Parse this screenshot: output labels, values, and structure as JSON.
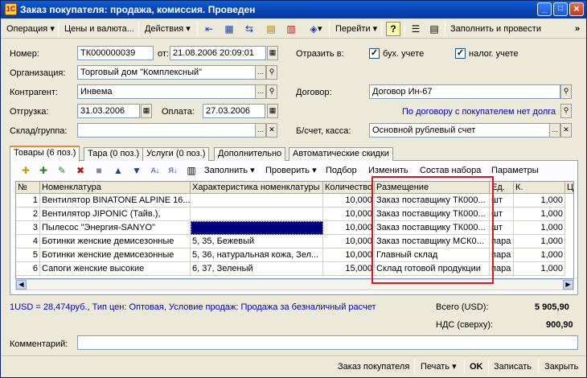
{
  "window": {
    "title": "Заказ покупателя: продажа, комиссия. Проведен",
    "minimize": "_",
    "maximize": "□",
    "close": "×"
  },
  "toolbar": {
    "operation": "Операция",
    "prices": "Цены и валюта...",
    "actions": "Действия",
    "goto": "Перейти",
    "help": "?",
    "fill_post": "Заполнить и провести",
    "overflow": "»"
  },
  "header": {
    "number_label": "Номер:",
    "number_value": "ТК000000039",
    "from_label": "от:",
    "date_value": "21.08.2006 20:09:01",
    "reflect_label": "Отразить в:",
    "accounting_label": "бух. учете",
    "tax_label": "налог. учете",
    "org_label": "Организация:",
    "org_value": "Торговый дом \"Комплексный\"",
    "contractor_label": "Контрагент:",
    "contractor_value": "Инвема",
    "contract_label": "Договор:",
    "contract_value": "Договор Ин-67",
    "shipment_label": "Отгрузка:",
    "shipment_value": "31.03.2006",
    "payment_label": "Оплата:",
    "payment_value": "27.03.2006",
    "contract_note": "По договору с покупателем нет долга",
    "warehouse_label": "Склад/группа:",
    "warehouse_value": "",
    "bank_label": "Б/счет, касса:",
    "bank_value": "Основной рублевый счет"
  },
  "tabs": [
    {
      "label": "Товары (6 поз.)"
    },
    {
      "label": "Тара (0 поз.)"
    },
    {
      "label": "Услуги (0 поз.)"
    },
    {
      "label": "Дополнительно"
    },
    {
      "label": "Автоматические скидки"
    }
  ],
  "grid_toolbar": {
    "fill": "Заполнить",
    "check": "Проверить",
    "pick": "Подбор",
    "change": "Изменить",
    "kit": "Состав набора",
    "params": "Параметры"
  },
  "table": {
    "headers": [
      "№",
      "Номенклатура",
      "Характеристика номенклатуры",
      "Количество",
      "Размещение",
      "Ед.",
      "К.",
      "Ц"
    ],
    "rows": [
      [
        "1",
        "Вентилятор BINATONE ALPINE 16...",
        "",
        "10,000",
        "Заказ поставщику ТК000...",
        "шт",
        "1,000"
      ],
      [
        "2",
        "Вентилятор JIPONIC (Тайв.),",
        "",
        "10,000",
        "Заказ поставщику ТК000...",
        "шт",
        "1,000"
      ],
      [
        "3",
        "Пылесос \"Энергия-SANYO\"",
        "",
        "10,000",
        "Заказ поставщику ТК000...",
        "шт",
        "1,000"
      ],
      [
        "4",
        "Ботинки женские демисезонные",
        "5, 35, Бежевый",
        "10,000",
        "Заказ поставщику МСК0...",
        "пара",
        "1,000"
      ],
      [
        "5",
        "Ботинки женские демисезонные",
        "5, 36, натуральная кожа, Зел...",
        "10,000",
        "Главный склад",
        "пара",
        "1,000"
      ],
      [
        "6",
        "Сапоги женские высокие",
        "6, 37, Зеленый",
        "15,000",
        "Склад готовой продукции",
        "пара",
        "1,000"
      ]
    ]
  },
  "footer": {
    "price_info": "1USD = 28,474руб., Тип цен: Оптовая, Условие продаж: Продажа за безналичный расчет",
    "total_label": "Всего (USD):",
    "total_value": "5 905,90",
    "vat_label": "НДС (сверху):",
    "vat_value": "900,90",
    "comment_label": "Комментарий:",
    "comment_value": ""
  },
  "bottom": {
    "order": "Заказ покупателя",
    "print": "Печать",
    "ok": "OK",
    "save": "Записать",
    "close": "Закрыть"
  },
  "colors": {
    "title_bar": "#0842b0",
    "link": "#0000c0",
    "selected_cell": "#00007f",
    "highlight_box": "#e0141e"
  }
}
